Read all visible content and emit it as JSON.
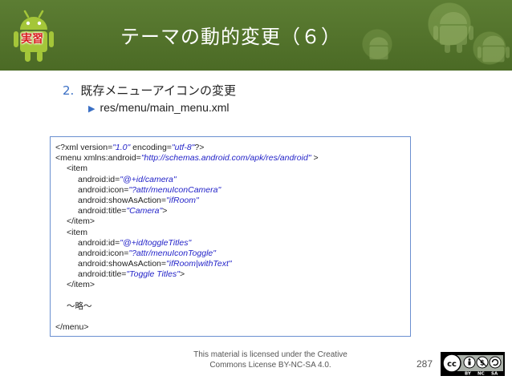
{
  "header": {
    "badge": "実習",
    "title": "テーマの動的変更（６）"
  },
  "content": {
    "item_number": "2.",
    "item_text": "既存メニューアイコンの変更",
    "subitem_text": "res/menu/main_menu.xml"
  },
  "code": {
    "line1_a": "<?xml version=",
    "line1_b": "\"1.0\"",
    "line1_c": " encoding=",
    "line1_d": "\"utf-8\"",
    "line1_e": "?>",
    "line2_a": "<menu xmlns:android=",
    "line2_b": "\"http://schemas.android.com/apk/res/android\"",
    "line2_c": " >",
    "line3": "<item",
    "line4_a": "android:id=",
    "line4_b": "\"@+id/camera\"",
    "line5_a": "android:icon=",
    "line5_b": "\"?attr/menuIconCamera\"",
    "line6_a": "android:showAsAction=",
    "line6_b": "\"ifRoom\"",
    "line7_a": "android:title=",
    "line7_b": "\"Camera\"",
    "line7_c": ">",
    "line8": "</item>",
    "line9": "<item",
    "line10_a": "android:id=",
    "line10_b": "\"@+id/toggleTitles\"",
    "line11_a": "android:icon=",
    "line11_b": "\"?attr/menuIconToggle\"",
    "line12_a": "android:showAsAction=",
    "line12_b": "\"ifRoom|withText\"",
    "line13_a": "android:title=",
    "line13_b": "\"Toggle Titles\"",
    "line13_c": ">",
    "line14": "</item>",
    "line15": "～略～",
    "line16": "</menu>"
  },
  "footer": {
    "license_line1": "This material is licensed under the Creative",
    "license_line2": "Commons License BY-NC-SA 4.0.",
    "page_number": "287"
  },
  "colors": {
    "header_bg": "#4f6f28",
    "badge_red": "#d81e1e",
    "accent_blue": "#3a6fc4",
    "string_blue": "#2323c8"
  },
  "icons": [
    "android-robot-icon",
    "creative-commons-by-nc-sa-icon"
  ]
}
